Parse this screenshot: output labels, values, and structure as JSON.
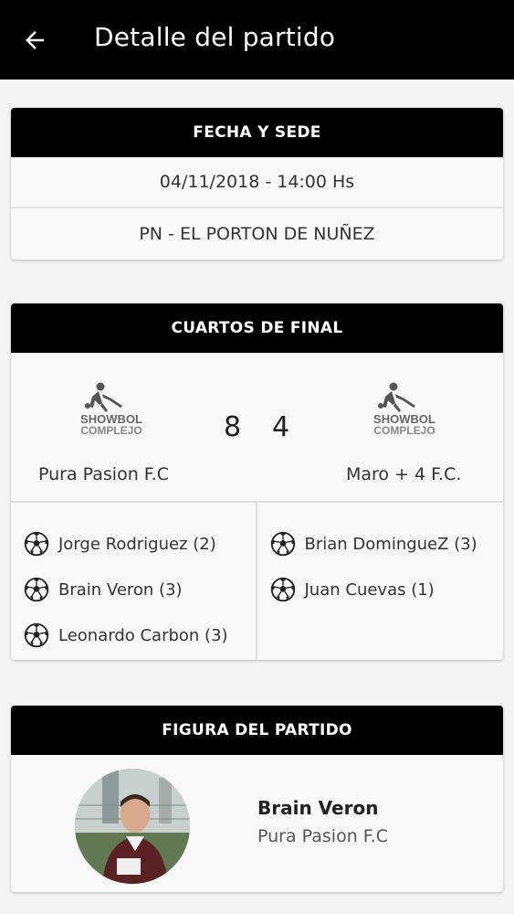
{
  "appbar": {
    "title": "Detalle del partido",
    "back_icon": "arrow-left-icon"
  },
  "venue_card": {
    "header": "FECHA Y SEDE",
    "datetime": "04/11/2018 - 14:00 Hs",
    "venue": "PN - EL PORTON DE NUÑEZ"
  },
  "match_card": {
    "header": "CUARTOS DE FINAL",
    "home": {
      "name": "Pura Pasion F.C",
      "logo_text_1": "SHOWBOL",
      "logo_text_2": "COMPLEJO",
      "score": "8",
      "scorers": [
        "Jorge Rodriguez (2)",
        "Brain Veron (3)",
        "Leonardo Carbon (3)"
      ]
    },
    "away": {
      "name": "Maro + 4 F.C.",
      "logo_text_1": "SHOWBOL",
      "logo_text_2": "COMPLEJO",
      "score": "4",
      "scorers": [
        "Brian DominguеZ (3)",
        "Juan Cuevas (1)"
      ]
    }
  },
  "mvp_card": {
    "header": "FIGURA DEL PARTIDO",
    "player_name": "Brain Veron",
    "player_team": "Pura Pasion F.C"
  },
  "colors": {
    "header_bg": "#000000",
    "card_bg": "#f8f8f8",
    "page_bg": "#f4f4f4"
  }
}
